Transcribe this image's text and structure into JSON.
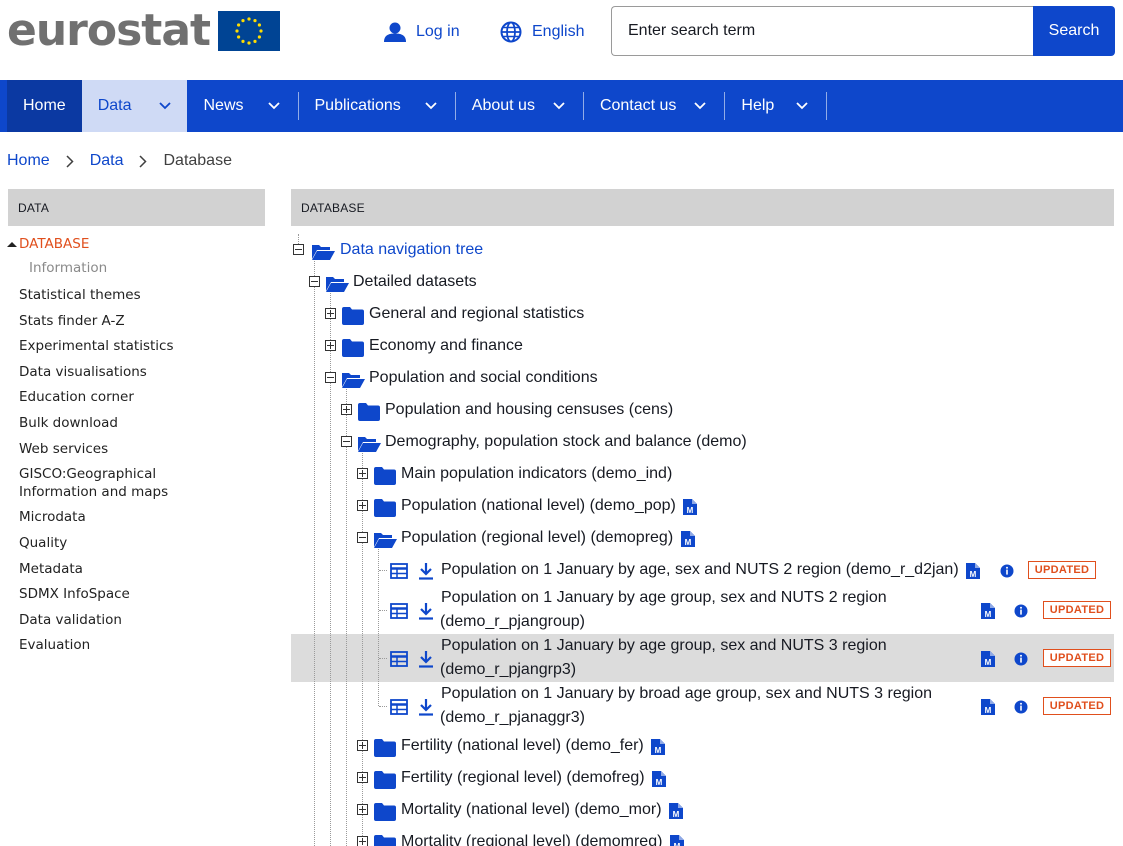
{
  "header": {
    "logo_text": "eurostat",
    "login_label": "Log in",
    "language_label": "English",
    "search_placeholder": "Enter search term",
    "search_button": "Search"
  },
  "nav": {
    "items": [
      {
        "label": "Home"
      },
      {
        "label": "Data"
      },
      {
        "label": "News"
      },
      {
        "label": "Publications"
      },
      {
        "label": "About us"
      },
      {
        "label": "Contact us"
      },
      {
        "label": "Help"
      }
    ]
  },
  "breadcrumb": [
    "Home",
    "Data",
    "Database"
  ],
  "sidebar": {
    "heading": "DATA",
    "active": "DATABASE",
    "sub": "Information",
    "items": [
      "Statistical themes",
      "Stats finder A-Z",
      "Experimental statistics",
      "Data visualisations",
      "Education corner",
      "Bulk download",
      "Web services",
      "GISCO:Geographical Information and maps",
      "Microdata",
      "Quality",
      "Metadata",
      "SDMX InfoSpace",
      "Data validation",
      "Evaluation"
    ]
  },
  "main": {
    "heading": "DATABASE",
    "tree": {
      "root": "Data navigation tree",
      "detailed": "Detailed datasets",
      "level1": [
        "General and regional statistics",
        "Economy and finance",
        "Population and social conditions"
      ],
      "level2": [
        "Population and housing censuses (cens)",
        "Demography, population stock and balance (demo)"
      ],
      "level3": [
        "Main population indicators (demo_ind)",
        "Population (national level) (demo_pop)",
        "Population (regional level) (demopreg)"
      ],
      "datasets": [
        {
          "line1": "Population on 1 January by age, sex and NUTS 2 region (demo_r_d2jan)",
          "line2": "",
          "badge": "UPDATED"
        },
        {
          "line1": "Population on 1 January by age group, sex and NUTS 2 region",
          "line2": "(demo_r_pjangroup)",
          "badge": "UPDATED"
        },
        {
          "line1": "Population on 1 January by age group, sex and NUTS 3 region",
          "line2": "(demo_r_pjangrp3)",
          "badge": "UPDATED"
        },
        {
          "line1": "Population on 1 January by broad age group, sex and NUTS 3 region",
          "line2": "(demo_r_pjanaggr3)",
          "badge": "UPDATED"
        }
      ],
      "level3_after": [
        "Fertility (national level) (demo_fer)",
        "Fertility (regional level) (demofreg)",
        "Mortality (national level) (demo_mor)",
        "Mortality (regional level) (demomreg)"
      ]
    }
  },
  "colors": {
    "brand_blue": "#0e47cb",
    "accent_orange": "#e04f1d",
    "header_grey": "#d2d2d2"
  }
}
